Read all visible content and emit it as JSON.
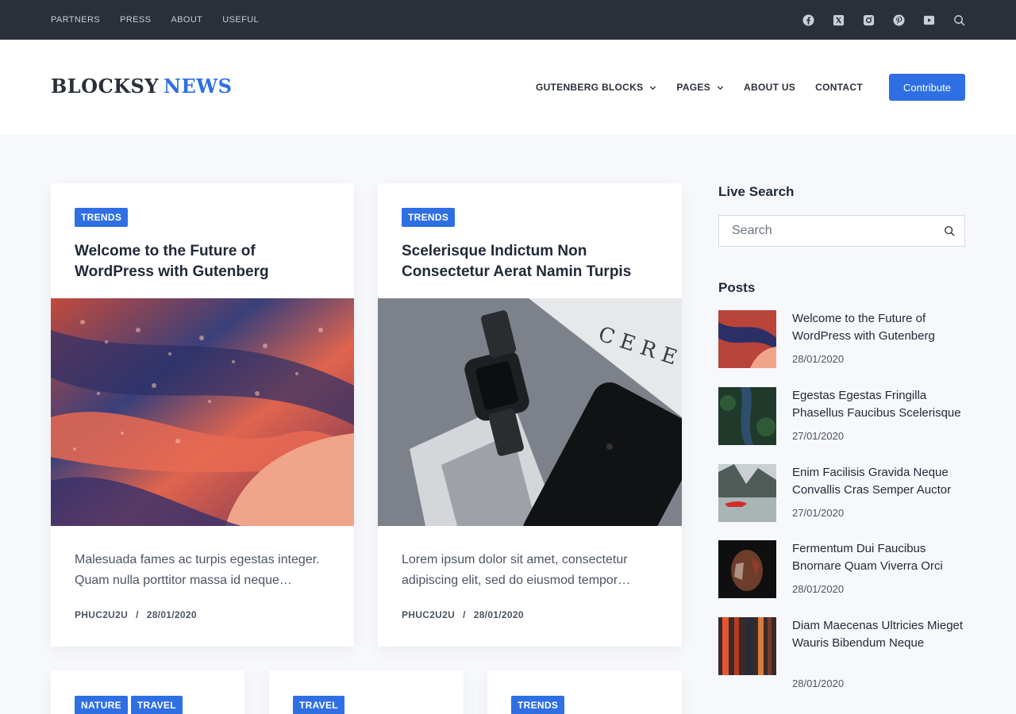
{
  "topbar": {
    "links": [
      "PARTNERS",
      "PRESS",
      "ABOUT",
      "USEFUL"
    ],
    "social_icons": [
      "facebook-icon",
      "x-twitter-icon",
      "instagram-icon",
      "pinterest-icon",
      "youtube-icon",
      "search-icon"
    ]
  },
  "header": {
    "logo_part1": "BLOCKSY",
    "logo_part2": "NEWS",
    "nav": [
      {
        "label": "GUTENBERG BLOCKS",
        "has_dropdown": true
      },
      {
        "label": "PAGES",
        "has_dropdown": true
      },
      {
        "label": "ABOUT US",
        "has_dropdown": false
      },
      {
        "label": "CONTACT",
        "has_dropdown": false
      }
    ],
    "cta_label": "Contribute"
  },
  "colors": {
    "accent": "#2f6fe4",
    "topbar_bg": "#2a303a",
    "page_bg": "#f7f8fb"
  },
  "posts": [
    {
      "tag": "TRENDS",
      "title": "Welcome to the Future of WordPress with Gutenberg",
      "excerpt": "Malesuada fames ac turpis egestas integer. Quam nulla porttitor massa id neque…",
      "author": "PHUC2U2U",
      "separator": "/",
      "date": "28/01/2020"
    },
    {
      "tag": "TRENDS",
      "title": "Scelerisque Indictum Non Consectetur Aerat Namin Turpis",
      "excerpt": "Lorem ipsum dolor sit amet, consectetur adipiscing elit, sed do eiusmod tempor…",
      "author": "PHUC2U2U",
      "separator": "/",
      "date": "28/01/2020"
    }
  ],
  "lower_cards": [
    {
      "tags": [
        "NATURE",
        "TRAVEL"
      ]
    },
    {
      "tags": [
        "TRAVEL"
      ]
    },
    {
      "tags": [
        "TRENDS"
      ]
    }
  ],
  "sidebar": {
    "search_heading": "Live Search",
    "search_placeholder": "Search",
    "posts_heading": "Posts",
    "posts": [
      {
        "title": "Welcome to the Future of WordPress with Gutenberg",
        "date": "28/01/2020"
      },
      {
        "title": "Egestas Egestas Fringilla Phasellus Faucibus Scelerisque",
        "date": "27/01/2020"
      },
      {
        "title": "Enim Facilisis Gravida Neque Convallis Cras Semper Auctor",
        "date": "27/01/2020"
      },
      {
        "title": "Fermentum Dui Faucibus Bnornare Quam Viverra Orci",
        "date": "28/01/2020"
      },
      {
        "title": "Diam Maecenas Ultricies Mieget Wauris Bibendum Neque",
        "date": "28/01/2020"
      }
    ]
  }
}
